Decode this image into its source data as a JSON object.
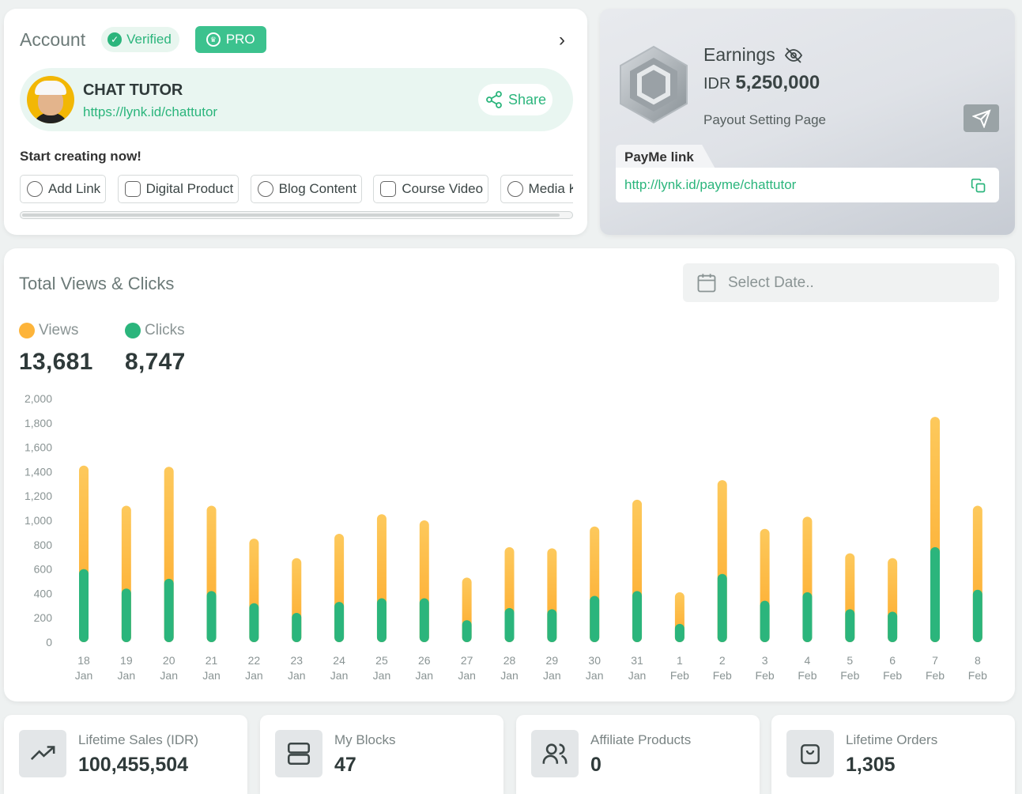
{
  "account": {
    "title": "Account",
    "verified_label": "Verified",
    "pro_label": "PRO",
    "profile": {
      "name": "CHAT TUTOR",
      "url": "https://lynk.id/chattutor",
      "share_label": "Share"
    },
    "start_title": "Start creating now!",
    "chips": [
      "Add Link",
      "Digital Product",
      "Blog Content",
      "Course Video",
      "Media Ki"
    ]
  },
  "earnings": {
    "label": "Earnings",
    "currency": "IDR",
    "amount": "5,250,000",
    "payout_link": "Payout Setting Page",
    "payme_label": "PayMe link",
    "payme_url": "http://lynk.id/payme/chattutor"
  },
  "stats_panel": {
    "title": "Total Views & Clicks",
    "date_placeholder": "Select Date..",
    "views_label": "Views",
    "views_total": "13,681",
    "clicks_label": "Clicks",
    "clicks_total": "8,747"
  },
  "colors": {
    "views": "#fdb43a",
    "clicks": "#2bb57c",
    "accent": "#3cc28e"
  },
  "chart_data": {
    "type": "bar",
    "stacked": true,
    "ylim": [
      0,
      2000
    ],
    "yticks": [
      "0",
      "200",
      "400",
      "600",
      "800",
      "1,000",
      "1,200",
      "1,400",
      "1,600",
      "1,800",
      "2,000"
    ],
    "categories": [
      [
        "18",
        "Jan"
      ],
      [
        "19",
        "Jan"
      ],
      [
        "20",
        "Jan"
      ],
      [
        "21",
        "Jan"
      ],
      [
        "22",
        "Jan"
      ],
      [
        "23",
        "Jan"
      ],
      [
        "24",
        "Jan"
      ],
      [
        "25",
        "Jan"
      ],
      [
        "26",
        "Jan"
      ],
      [
        "27",
        "Jan"
      ],
      [
        "28",
        "Jan"
      ],
      [
        "29",
        "Jan"
      ],
      [
        "30",
        "Jan"
      ],
      [
        "31",
        "Jan"
      ],
      [
        "1",
        "Feb"
      ],
      [
        "2",
        "Feb"
      ],
      [
        "3",
        "Feb"
      ],
      [
        "4",
        "Feb"
      ],
      [
        "5",
        "Feb"
      ],
      [
        "6",
        "Feb"
      ],
      [
        "7",
        "Feb"
      ],
      [
        "8",
        "Feb"
      ]
    ],
    "series": [
      {
        "name": "Views",
        "values": [
          1450,
          1120,
          1440,
          1120,
          850,
          690,
          890,
          1050,
          1000,
          530,
          780,
          770,
          950,
          1170,
          410,
          1330,
          930,
          1030,
          730,
          690,
          1850,
          1120
        ]
      },
      {
        "name": "Clicks",
        "values": [
          600,
          440,
          520,
          420,
          320,
          240,
          330,
          360,
          360,
          180,
          280,
          270,
          380,
          420,
          150,
          560,
          340,
          410,
          270,
          250,
          780,
          430
        ]
      }
    ]
  },
  "stat_cards": [
    {
      "label": "Lifetime Sales (IDR)",
      "value": "100,455,504",
      "icon": "trending-up-icon"
    },
    {
      "label": "My Blocks",
      "value": "47",
      "icon": "server-icon"
    },
    {
      "label": "Affiliate Products",
      "value": "0",
      "icon": "users-icon"
    },
    {
      "label": "Lifetime Orders",
      "value": "1,305",
      "icon": "shopping-bag-icon"
    }
  ]
}
